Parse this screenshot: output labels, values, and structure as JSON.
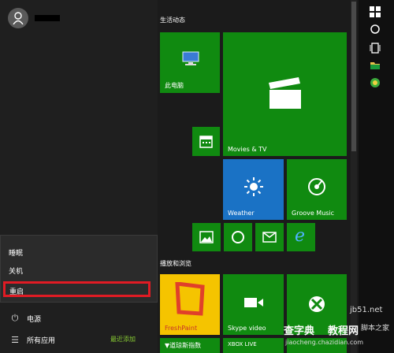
{
  "power_menu": {
    "sleep": "睡眠",
    "shutdown": "关机",
    "restart": "重启"
  },
  "bottom": {
    "power": "电源",
    "all_apps": "所有应用",
    "recently_added": "最近添加"
  },
  "groups": {
    "life": "生活动态",
    "play": "播放和浏览"
  },
  "tiles": {
    "this_pc": "此电脑",
    "movies": "Movies & TV",
    "weather": "Weather",
    "groove": "Groove Music",
    "freshpaint": "FreshPaint",
    "skype": "Skype video",
    "xbox_live": "XBOX LIVE",
    "bottom_left": "▼道琼斯指数"
  },
  "watermark": {
    "site": "jb51.net",
    "brand": "脚本之家",
    "url": "jiaocheng.chazidian.com",
    "tag": "教程网",
    "logo": "查字典"
  },
  "colors": {
    "tile_green": "#108a10",
    "weather_blue": "#1a72c5",
    "fresh_yellow": "#f5c400",
    "highlight_red": "#e01b24"
  }
}
